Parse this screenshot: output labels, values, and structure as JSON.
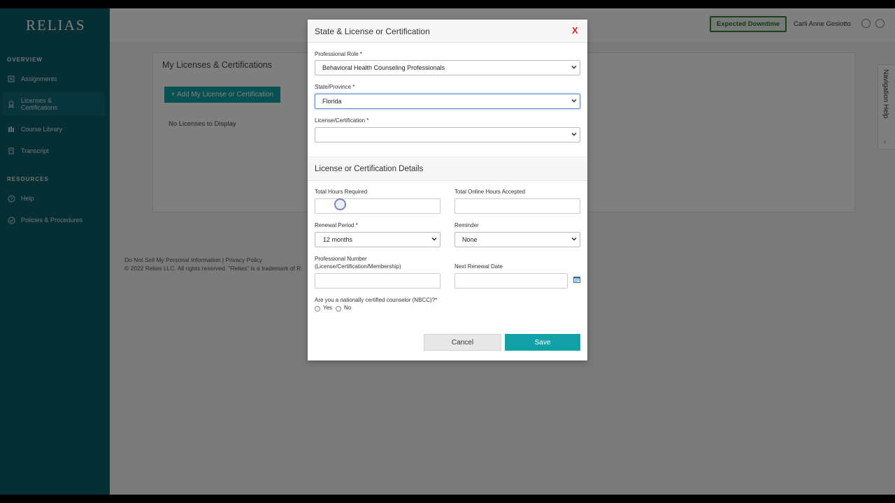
{
  "sidebar": {
    "logo": "RELIAS",
    "overview_heading": "OVERVIEW",
    "resources_heading": "RESOURCES",
    "items": [
      {
        "label": "Assignments",
        "icon": "list-icon"
      },
      {
        "label": "Licenses & Certifications",
        "icon": "badge-icon"
      },
      {
        "label": "Course Library",
        "icon": "library-icon"
      },
      {
        "label": "Transcript",
        "icon": "transcript-icon"
      }
    ],
    "resources": [
      {
        "label": "Help",
        "icon": "help-icon"
      },
      {
        "label": "Policies & Procedures",
        "icon": "check-circle-icon"
      }
    ]
  },
  "topbar": {
    "downtime_label": "Expected Downtime",
    "user_name": "Carli Anne Gesiotto"
  },
  "main": {
    "title": "My Licenses & Certifications",
    "add_button": "+ Add My License or Certification",
    "empty_text": "No Licenses to Display"
  },
  "footer": {
    "links": "Do Not Sell My Personal Information | Privacy Policy",
    "copyright": "© 2022 Relias LLC. All rights reserved. \"Relias\" is a trademark of R"
  },
  "nav_help": {
    "label": "Navigation Help"
  },
  "modal": {
    "title": "State & License or Certification",
    "close_label": "X",
    "professional_role": {
      "label": "Professional Role *",
      "value": "Behavioral Health Counseling Professionals"
    },
    "state": {
      "label": "State/Province *",
      "value": "Florida"
    },
    "license": {
      "label": "License/Certification *",
      "value": ""
    },
    "details_title": "License or Certification Details",
    "total_hours": {
      "label": "Total Hours Required",
      "value": ""
    },
    "online_hours": {
      "label": "Total Online Hours Accepted",
      "value": ""
    },
    "renewal_period": {
      "label": "Renewal Period *",
      "value": "12 months"
    },
    "reminder": {
      "label": "Reminder",
      "value": "None"
    },
    "professional_number": {
      "label_line1": "Professional Number",
      "label_line2": "(License/Certification/Membership)",
      "value": ""
    },
    "next_renewal": {
      "label": "Next Renewal Date",
      "value": ""
    },
    "nbcc": {
      "question": "Are you a nationally certified counselor (NBCC)?*",
      "yes": "Yes",
      "no": "No"
    },
    "cancel_label": "Cancel",
    "save_label": "Save"
  },
  "colors": {
    "sidebar_bg": "#0d5f6b",
    "accent_teal": "#12a1a6",
    "close_red": "#dd2222",
    "downtime_green": "#3a7f3a"
  }
}
